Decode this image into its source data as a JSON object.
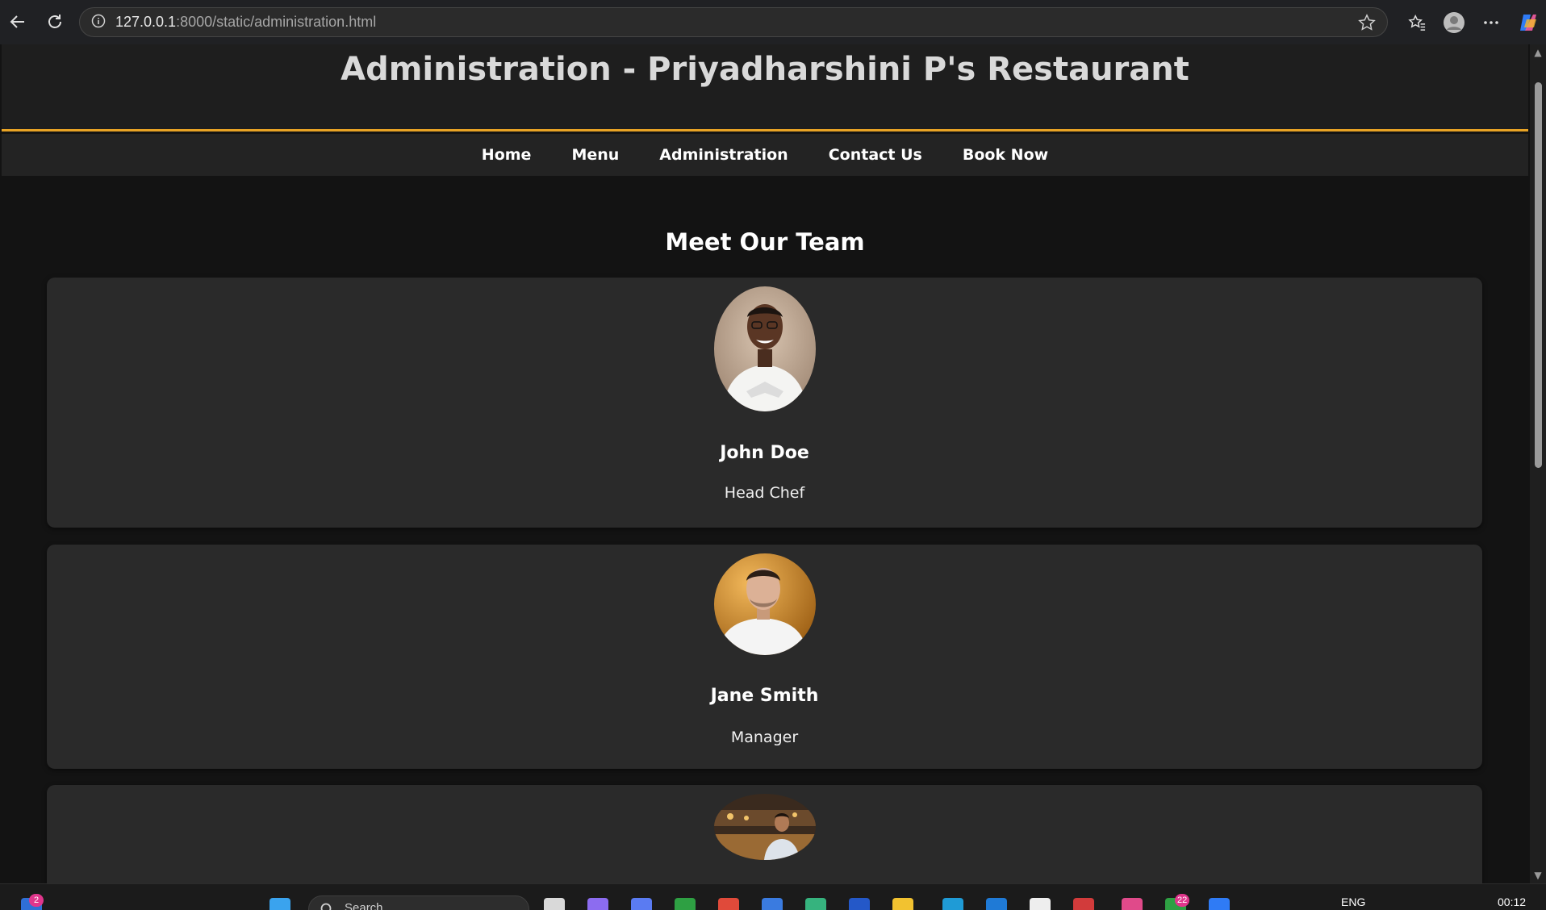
{
  "browser": {
    "url_host": "127.0.0.1",
    "url_rest": ":8000/static/administration.html"
  },
  "page": {
    "title": "Administration - Priyadharshini P's Restaurant",
    "nav": [
      "Home",
      "Menu",
      "Administration",
      "Contact Us",
      "Book Now"
    ],
    "section_title": "Meet Our Team",
    "team": [
      {
        "name": "John Doe",
        "role": "Head Chef"
      },
      {
        "name": "Jane Smith",
        "role": "Manager"
      },
      {
        "name": "",
        "role": ""
      }
    ]
  },
  "taskbar": {
    "search_placeholder": "Search",
    "language": "ENG",
    "time": "00:12",
    "badges": {
      "widgets": "2",
      "app_a": "22"
    }
  },
  "colors": {
    "accent": "#e8a325",
    "header_bg": "#1e1e1e",
    "card_bg": "#2a2a2a",
    "page_bg": "#131313"
  }
}
